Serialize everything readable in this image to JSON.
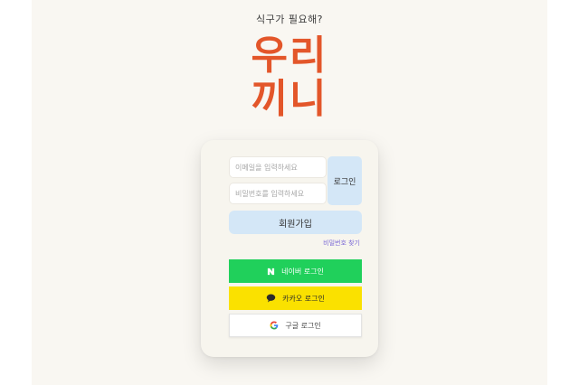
{
  "header": {
    "tagline": "식구가 필요해?",
    "logo_line1": "우리",
    "logo_line2": "끼니"
  },
  "login_form": {
    "email_placeholder": "이메일을 입력하세요",
    "password_placeholder": "비밀번호를 입력하세요",
    "login_label": "로그인",
    "signup_label": "회원가입",
    "find_password_label": "비밀번호 찾기"
  },
  "social_login": {
    "naver_label": "네이버 로그인",
    "kakao_label": "카카오 로그인",
    "google_label": "구글 로그인"
  },
  "colors": {
    "brand_orange": "#e3562a",
    "button_blue": "#d4e7f7",
    "naver_green": "#20d05b",
    "kakao_yellow": "#fae100",
    "link_purple": "#7c6ad6"
  },
  "icons": {
    "naver": "naver-n-icon",
    "kakao": "kakao-speech-bubble-icon",
    "google": "google-g-icon"
  }
}
